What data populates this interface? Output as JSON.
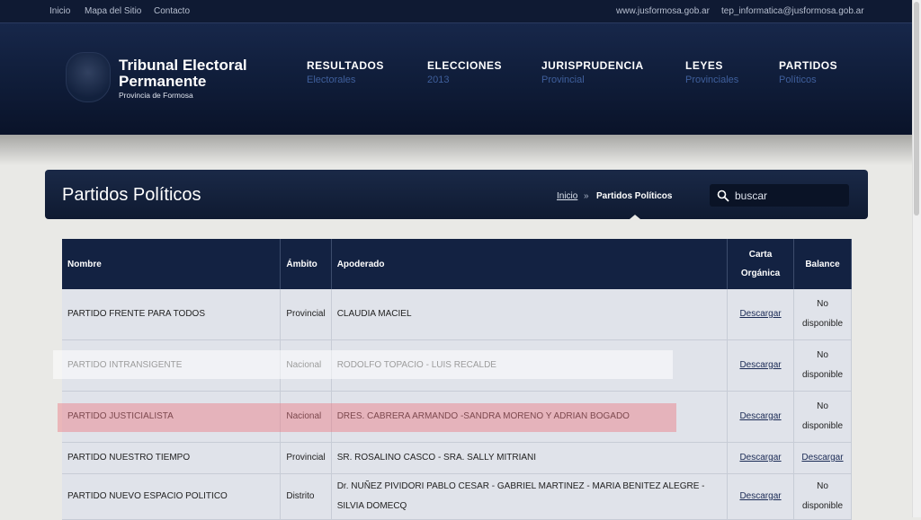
{
  "topbar": {
    "links": [
      "Inicio",
      "Mapa del Sitio",
      "Contacto"
    ],
    "website": "www.jusformosa.gob.ar",
    "email": "tep_informatica@jusformosa.gob.ar"
  },
  "logo": {
    "title_line1": "Tribunal Electoral",
    "title_line2": "Permanente",
    "subtitle": "Provincia de Formosa"
  },
  "nav": [
    {
      "main": "RESULTADOS",
      "sub": "Electorales"
    },
    {
      "main": "ELECCIONES",
      "sub": "2013"
    },
    {
      "main": "JURISPRUDENCIA",
      "sub": "Provincial"
    },
    {
      "main": "LEYES",
      "sub": "Provinciales"
    },
    {
      "main": "PARTIDOS",
      "sub": "Políticos"
    }
  ],
  "page": {
    "title": "Partidos Políticos",
    "breadcrumb_home": "Inicio",
    "breadcrumb_sep": "»",
    "breadcrumb_current": "Partidos Políticos",
    "search_placeholder": "buscar"
  },
  "table": {
    "headers": {
      "nombre": "Nombre",
      "ambito": "Ámbito",
      "apoderado": "Apoderado",
      "carta_line1": "Carta",
      "carta_line2": "Orgánica",
      "balance": "Balance"
    },
    "rows": [
      {
        "nombre": "PARTIDO FRENTE PARA TODOS",
        "ambito": "Provincial",
        "apoderado": "CLAUDIA MACIEL",
        "carta": "Descargar",
        "balance_1": "No",
        "balance_2": "disponible"
      },
      {
        "nombre": "PARTIDO INTRANSIGENTE",
        "ambito": "Nacional",
        "apoderado": "RODOLFO TOPACIO - LUIS RECALDE",
        "carta": "Descargar",
        "balance_1": "No",
        "balance_2": "disponible"
      },
      {
        "nombre": "PARTIDO JUSTICIALISTA",
        "ambito": "Nacional",
        "apoderado": "DRES. CABRERA ARMANDO -SANDRA MORENO Y ADRIAN BOGADO",
        "carta": "Descargar",
        "balance_1": "No",
        "balance_2": "disponible"
      },
      {
        "nombre": "PARTIDO NUESTRO TIEMPO",
        "ambito": "Provincial",
        "apoderado": "SR. ROSALINO CASCO - SRA. SALLY MITRIANI",
        "carta": "Descargar",
        "balance": "Descargar"
      },
      {
        "nombre": "PARTIDO NUEVO ESPACIO POLITICO",
        "ambito": "Distrito",
        "apoderado_1": "Dr. NUÑEZ PIVIDORI PABLO CESAR - GABRIEL MARTINEZ - MARIA BENITEZ ALEGRE -",
        "apoderado_2": "SILVIA DOMECQ",
        "carta": "Descargar",
        "balance_1": "No",
        "balance_2": "disponible"
      }
    ]
  }
}
